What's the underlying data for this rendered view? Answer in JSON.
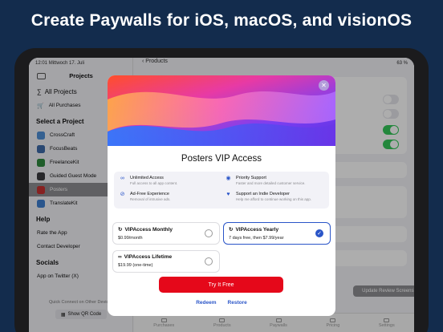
{
  "headline": "Create Paywalls for iOS, macOS, and visionOS",
  "statusbar": {
    "time": "12:01",
    "date": "Mittwoch 17. Juli",
    "battery": "63 %"
  },
  "sidebar": {
    "title": "Projects",
    "all_projects": "All Projects",
    "all_purchases": "All Purchases",
    "select_project": "Select a Project",
    "projects": [
      {
        "label": "CrossCraft",
        "color": "#4e8fd6"
      },
      {
        "label": "FocusBeats",
        "color": "#3f6aa8"
      },
      {
        "label": "FreelanceKit",
        "color": "#2f8a3e"
      },
      {
        "label": "Guided Guest Mode",
        "color": "#3b3b40"
      },
      {
        "label": "Posters",
        "color": "#c83232"
      },
      {
        "label": "TranslateKit",
        "color": "#3f7fd0"
      }
    ],
    "help_section": "Help",
    "rate_app": "Rate the App",
    "contact_dev": "Contact Developer",
    "socials_section": "Socials",
    "twitter": "App on Twitter (X)",
    "quick_connect": "Quick Connect on Other Devices",
    "qr_button": "Show QR Code"
  },
  "main": {
    "back_title": "Products",
    "update_button": "Update Review Screenshots",
    "tabs": [
      "Purchases",
      "Products",
      "Paywalls",
      "Pricing",
      "Settings"
    ],
    "active_tab": "Paywalls"
  },
  "paywall": {
    "title": "Posters VIP Access",
    "features": [
      {
        "icon": "infinity-icon",
        "title": "Unlimited Access",
        "subtitle": "Full access to all app content."
      },
      {
        "icon": "priority-icon",
        "title": "Priority Support",
        "subtitle": "Faster and more detailed customer service."
      },
      {
        "icon": "no-ads-icon",
        "title": "Ad-Free Experience",
        "subtitle": "Removal of intrusive ads."
      },
      {
        "icon": "heart-icon",
        "title": "Support an Indie Developer",
        "subtitle": "Help me afford to continue working on this app."
      }
    ],
    "plans": [
      {
        "name": "VIPAccess Monthly",
        "price": "$0.99/month",
        "selected": false
      },
      {
        "name": "VIPAccess Yearly",
        "price": "7 days free, then $7.99/year",
        "selected": true
      },
      {
        "name": "VIPAccess Lifetime",
        "price": "$19.99 (one-time)",
        "selected": false
      }
    ],
    "cta": "Try It Free",
    "redeem": "Redeem",
    "restore": "Restore",
    "accent": "#2a55c8",
    "cta_color": "#e5081a"
  }
}
